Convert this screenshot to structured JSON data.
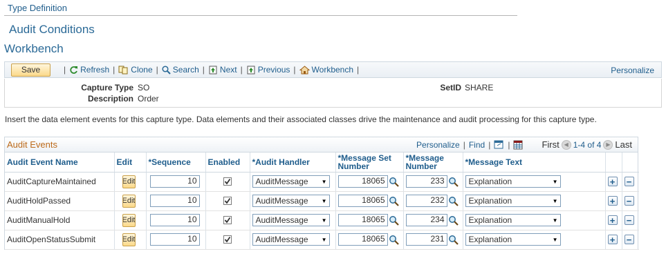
{
  "breadcrumb": "Type Definition",
  "subtitle": "Audit Conditions",
  "page_title": "Workbench",
  "toolbar": {
    "save_label": "Save",
    "refresh": "Refresh",
    "clone": "Clone",
    "search": "Search",
    "next": "Next",
    "previous": "Previous",
    "workbench": "Workbench",
    "personalize": "Personalize"
  },
  "header": {
    "capture_type_label": "Capture Type",
    "capture_type_value": "SO",
    "description_label": "Description",
    "description_value": "Order",
    "setid_label": "SetID",
    "setid_value": "SHARE"
  },
  "instructions": "Insert the data element events for this capture type. Data elements and their associated classes drive the maintenance and audit processing for this capture type.",
  "grid": {
    "title": "Audit Events",
    "personalize": "Personalize",
    "find": "Find",
    "first": "First",
    "range": "1-4 of 4",
    "last": "Last",
    "columns": {
      "event_name": "Audit Event Name",
      "edit": "Edit",
      "sequence": "*Sequence",
      "enabled": "Enabled",
      "handler": "*Audit Handler",
      "msg_set": "*Message Set Number",
      "msg_num": "*Message Number",
      "msg_text": "*Message Text"
    },
    "rows": [
      {
        "name": "AuditCaptureMaintained",
        "edit": "Edit",
        "sequence": "10",
        "enabled": true,
        "handler": "AuditMessage",
        "msg_set": "18065",
        "msg_num": "233",
        "msg_text": "Explanation"
      },
      {
        "name": "AuditHoldPassed",
        "edit": "Edit",
        "sequence": "10",
        "enabled": true,
        "handler": "AuditMessage",
        "msg_set": "18065",
        "msg_num": "232",
        "msg_text": "Explanation"
      },
      {
        "name": "AuditManualHold",
        "edit": "Edit",
        "sequence": "10",
        "enabled": true,
        "handler": "AuditMessage",
        "msg_set": "18065",
        "msg_num": "234",
        "msg_text": "Explanation"
      },
      {
        "name": "AuditOpenStatusSubmit",
        "edit": "Edit",
        "sequence": "10",
        "enabled": true,
        "handler": "AuditMessage",
        "msg_set": "18065",
        "msg_num": "231",
        "msg_text": "Explanation"
      }
    ]
  },
  "icons": {
    "refresh": "refresh-icon",
    "clone": "clone-icon",
    "search": "search-icon",
    "next": "next-icon",
    "previous": "previous-icon",
    "workbench": "home-icon",
    "prompt": "magnifier-icon",
    "add_row": "plus-icon",
    "delete_row": "minus-icon"
  },
  "colors": {
    "link": "#1f5d8c",
    "title": "#2b6a97",
    "grid_title": "#bc6a1a",
    "button_fill": "#fbd98a"
  }
}
